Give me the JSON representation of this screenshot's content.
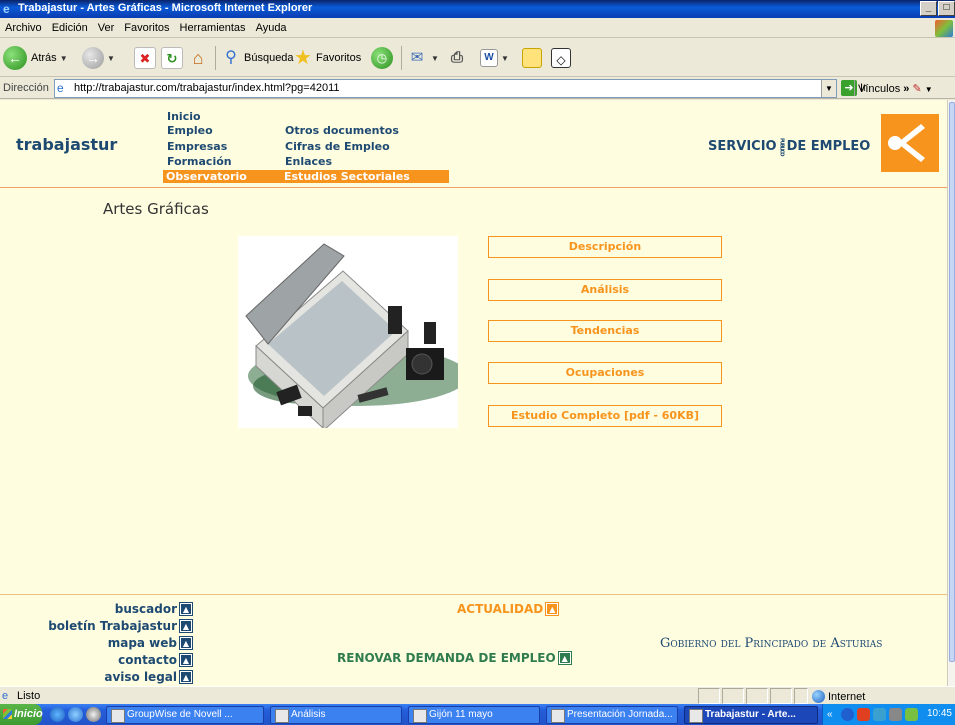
{
  "window": {
    "title": "Trabajastur - Artes Gráficas - Microsoft Internet Explorer",
    "controls": {
      "minimize": "_",
      "maximize": "□"
    }
  },
  "menu": [
    "Archivo",
    "Edición",
    "Ver",
    "Favoritos",
    "Herramientas",
    "Ayuda"
  ],
  "toolbar": {
    "back_label": "Atrás",
    "search_label": "Búsqueda",
    "favorites_label": "Favoritos"
  },
  "address": {
    "label": "Dirección",
    "url": "http://trabajastur.com/trabajastur/index.html?pg=42011",
    "go_label": "Ir",
    "links_label": "Vínculos"
  },
  "site": {
    "brand": "trabajastur",
    "nav_col1": [
      "Inicio",
      "Empleo",
      "Empresas",
      "Formación",
      "Observatorio"
    ],
    "nav_col2": [
      "Otros documentos",
      "Cifras de Empleo",
      "Enlaces",
      "Estudios Sectoriales"
    ],
    "sepe_left": "SERVICIO",
    "sepe_vertical": "PUBLICO",
    "sepe_right": "DE EMPLEO",
    "accent_color": "#f7941d",
    "brand_color": "#1e4a72"
  },
  "page": {
    "heading": "Artes Gráficas",
    "buttons": [
      "Descripción",
      "Análisis",
      "Tendencias",
      "Ocupaciones",
      "Estudio Completo [pdf - 60KB]"
    ]
  },
  "footer": {
    "links": [
      "buscador",
      "boletín Trabajastur",
      "mapa web",
      "contacto",
      "aviso legal"
    ],
    "actualidad": "ACTUALIDAD",
    "renovar": "RENOVAR DEMANDA DE EMPLEO",
    "gobierno": "Gobierno del Principado de Asturias"
  },
  "status": {
    "text": "Listo",
    "zone": "Internet"
  },
  "taskbar": {
    "start": "Inicio",
    "tasks": [
      "GroupWise de Novell ...",
      "Análisis",
      "Gijón 11 mayo",
      "Presentación Jornada...",
      "Trabajastur - Arte..."
    ],
    "clock": "10:45"
  }
}
